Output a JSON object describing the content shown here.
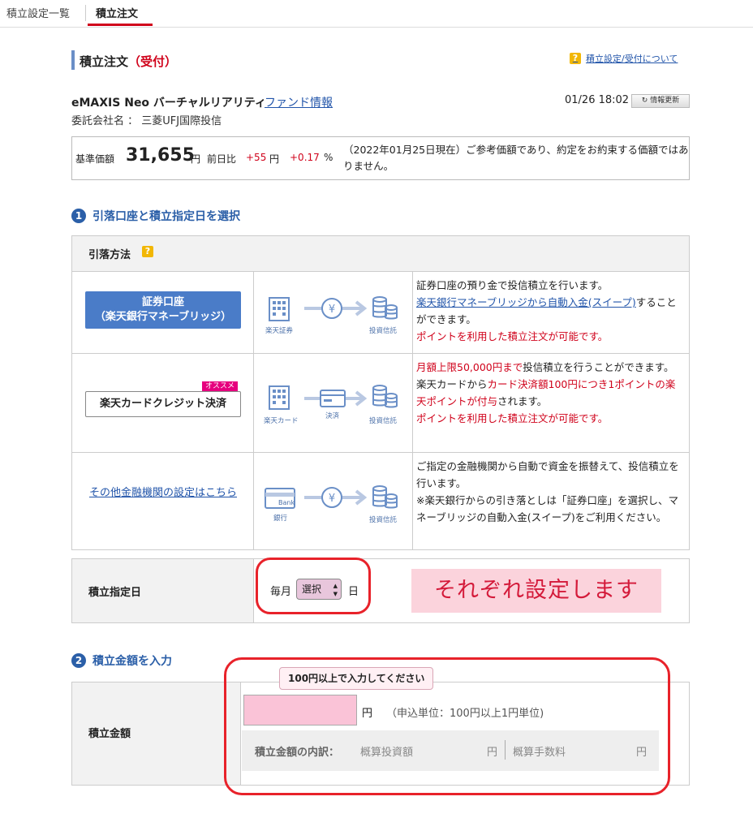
{
  "tabs": [
    {
      "label": "積立設定一覧"
    },
    {
      "label": "積立注文"
    }
  ],
  "header": {
    "title": "積立注文",
    "status": "（受付）",
    "help_link": "積立設定/受付について",
    "help_icon": "?"
  },
  "fund": {
    "name": "eMAXIS Neo バーチャルリアリティ",
    "info_link": "ファンド情報",
    "company": "委託会社名 ： 三菱UFJ国際投信",
    "timestamp": "01/26 18:02",
    "refresh_label": "情報更新"
  },
  "price": {
    "label": "基準価額",
    "value": "31,655",
    "unit": "円",
    "prev_label": "前日比",
    "prev_change": "+55",
    "prev_unit": "円",
    "prev_pct": "+0.17",
    "pct_unit": "%",
    "note": "（2022年01月25日現在）ご参考価額であり、約定をお約束する価額ではありません。"
  },
  "section1": {
    "num": "1",
    "title": "引落口座と積立指定日を選択",
    "method_header": "引落方法",
    "methods": [
      {
        "button_line1": "証券口座",
        "button_line2": "（楽天銀行マネーブリッジ）",
        "flow_from": "楽天証券",
        "flow_to": "投資信託",
        "desc1": "証券口座の預り金で投信積立を行います。",
        "desc_link": "楽天銀行マネーブリッジから自動入金(スイープ)",
        "desc2": "することができます。",
        "desc_red": "ポイントを利用した積立注文が可能です。"
      },
      {
        "badge": "オススメ",
        "button": "楽天カードクレジット決済",
        "flow_from": "楽天カード",
        "flow_mid": "決済",
        "flow_to": "投資信託",
        "desc_red1": "月額上限50,000円まで",
        "desc1": "投信積立を行うことができます。",
        "desc2": "楽天カードから",
        "desc_red2": "カード決済額100円につき1ポイントの楽天ポイントが付与",
        "desc3": "されます。",
        "desc_red3": "ポイントを利用した積立注文が可能です。"
      },
      {
        "link": "その他金融機関の設定はこちら",
        "flow_from": "銀行",
        "flow_bank": "Bank",
        "flow_to": "投資信託",
        "desc1": "ご指定の金融機関から自動で資金を振替えて、投信積立を行います。",
        "desc2": "※楽天銀行からの引き落としは「証券口座」を選択し、マネーブリッジの自動入金(スイープ)をご利用ください。"
      }
    ],
    "date_label": "積立指定日",
    "date_prefix": "毎月",
    "date_select": "選択",
    "date_suffix": "日",
    "banner": "それぞれ設定します"
  },
  "section2": {
    "num": "2",
    "title": "積立金額を入力",
    "amount_label": "積立金額",
    "tooltip": "100円以上で入力してください",
    "amount_value": "",
    "yen": "円",
    "unit_note": "（申込単位：100円以上1円単位)",
    "breakdown_label": "積立金額の内訳：",
    "breakdown_invest": "概算投資額",
    "breakdown_yen1": "円",
    "breakdown_fee": "概算手数料",
    "breakdown_yen2": "円"
  },
  "colors": {
    "accent_red": "#d0021b",
    "link_blue": "#2255aa",
    "section_blue": "#2b5fa8",
    "highlight_red": "#e8222a"
  }
}
